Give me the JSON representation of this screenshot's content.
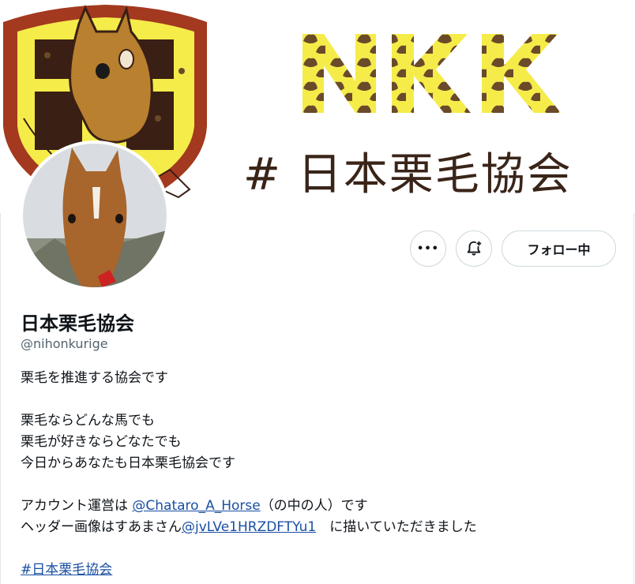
{
  "header": {
    "banner_title": "NKK",
    "banner_hashtag": "# 日本栗毛協会"
  },
  "actions": {
    "more_label": "•••",
    "follow_label": "フォロー中"
  },
  "profile": {
    "name": "日本栗毛協会",
    "handle": "@nihonkurige"
  },
  "bio": {
    "line1": "栗毛を推進する協会です",
    "line2": "栗毛ならどんな馬でも",
    "line3": "栗毛が好きならどなたでも",
    "line4": "今日からあなたも日本栗毛協会です",
    "line5_prefix": "アカウント運営は ",
    "line5_link": "@Chataro_A_Horse",
    "line5_suffix": "（の中の人）です",
    "line6_prefix": "ヘッダー画像はすあまさん",
    "line6_link": "@jvLVe1HRZDFTYu1",
    "line6_suffix": "　に描いていただきました",
    "hashtag": "#日本栗毛協会"
  },
  "colors": {
    "accent_link": "#1a4fa3",
    "banner_yellow": "#f5ec4a",
    "chestnut": "#6b3f1f",
    "crest_red": "#a3391f"
  }
}
